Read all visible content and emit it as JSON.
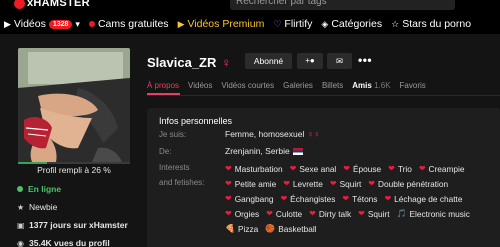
{
  "header": {
    "logo_text": "xHAMSTER",
    "search_placeholder": "Rechercher par tags",
    "nav": [
      {
        "icon": "camera-icon",
        "label": "Vidéos",
        "badge": "1328"
      },
      {
        "icon": "live-dot-icon",
        "label": "Cams gratuites"
      },
      {
        "icon": "camera-icon",
        "label": "Vidéos Premium"
      },
      {
        "icon": "heart-icon",
        "label": "Flirtify"
      },
      {
        "icon": "tag-icon",
        "label": "Catégories"
      },
      {
        "icon": "star-icon",
        "label": "Stars du porno"
      }
    ]
  },
  "profile": {
    "name": "Slavica_ZR",
    "gender_symbol": "♀",
    "subscribe_label": "Abonné",
    "add_friend_label": "+",
    "more_label": "•••",
    "completion_label": "Profil rempli à 26 %",
    "completion_value": 0.26
  },
  "tabs": [
    {
      "label": "À propos",
      "active": true
    },
    {
      "label": "Vidéos"
    },
    {
      "label": "Vidéos courtes"
    },
    {
      "label": "Galeries"
    },
    {
      "label": "Billets"
    },
    {
      "label": "Amis",
      "count": "1.6K"
    },
    {
      "label": "Favoris"
    }
  ],
  "sidebar": {
    "status": "En ligne",
    "rank": "Newbie",
    "days": "1377 jours sur xHamster",
    "views": "35.4K vues du profil"
  },
  "info": {
    "title": "Infos personnelles",
    "iam_label": "Je suis:",
    "iam_value": "Femme, homosexuel",
    "from_label": "De:",
    "from_value": "Zrenjanin, Serbie",
    "interests_label": "Interests",
    "fetishes_label": "and fetishes:",
    "fetishes": [
      [
        "Masturbation",
        "Sexe anal",
        "Épouse",
        "Trio",
        "Creampie"
      ],
      [
        "Petite amie",
        "Levrette",
        "Squirt",
        "Double pénétration"
      ],
      [
        "Gangbang",
        "Échangistes",
        "Tétons",
        "Léchage de chatte"
      ],
      [
        "Orgies",
        "Culotte",
        "Dirty talk",
        "Squirt",
        "Electronic music"
      ],
      [
        "Pizza",
        "Basketball"
      ]
    ]
  },
  "colors": {
    "accent": "#ec1c24",
    "pink": "#ec3c62",
    "online": "#4cc06d",
    "premium": "#f8c530"
  }
}
